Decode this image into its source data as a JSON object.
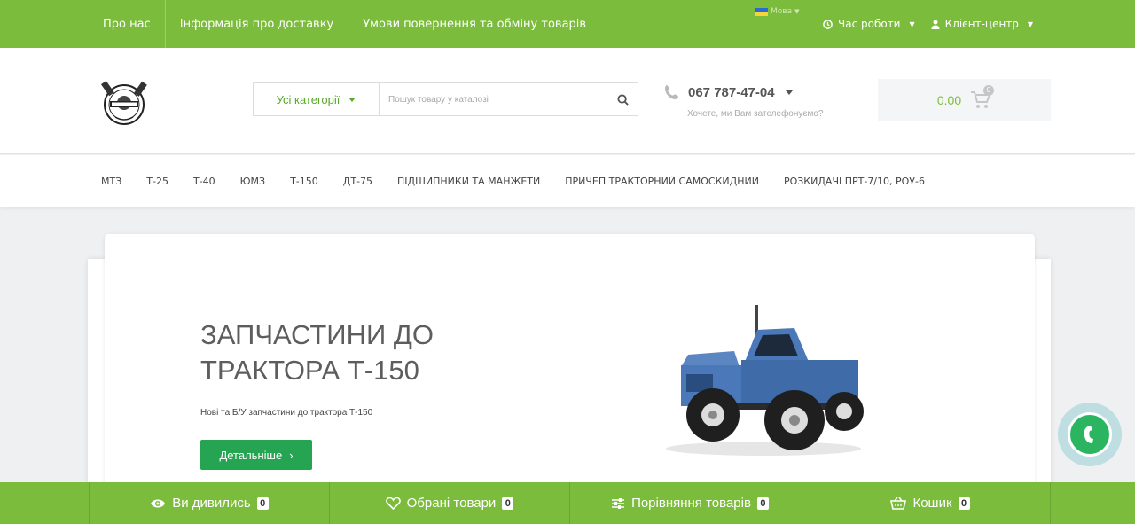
{
  "topbar": {
    "links": [
      "Про нас",
      "Інформація про доставку",
      "Умови повернення та обміну товарів"
    ],
    "language": "Мова",
    "hours": "Час роботи",
    "client_center": "Клієнт-центр"
  },
  "search": {
    "category_label": "Усі категорії",
    "placeholder": "Пошук товару у каталозі"
  },
  "phone": {
    "number": "067 787-47-04",
    "callback": "Хочете, ми Вам зателефонуємо?"
  },
  "cart": {
    "total": "0.00",
    "count": "0"
  },
  "menu": {
    "items": [
      "МТЗ",
      "Т-25",
      "Т-40",
      "ЮМЗ",
      "Т-150",
      "ДТ-75",
      "ПІДШИПНИКИ ТА МАНЖЕТИ",
      "ПРИЧЕП ТРАКТОРНИЙ САМОСКИДНИЙ",
      "РОЗКИДАЧІ ПРТ-7/10, РОУ-6"
    ]
  },
  "slide": {
    "title": "ЗАПЧАСТИНИ ДО ТРАКТОРА Т-150",
    "subtitle": "Нові та Б/У запчастини до трактора Т-150",
    "button": "Детальніше"
  },
  "bottombar": {
    "items": [
      {
        "label": "Ви дивились",
        "count": "0",
        "icon": "eye-icon"
      },
      {
        "label": "Обрані товари",
        "count": "0",
        "icon": "heart-icon"
      },
      {
        "label": "Порівняння товарів",
        "count": "0",
        "icon": "sliders-icon"
      },
      {
        "label": "Кошик",
        "count": "0",
        "icon": "basket-icon"
      }
    ]
  },
  "colors": {
    "brand_green": "#7cbc3d",
    "button_green": "#25a451",
    "tractor_blue": "#4a78b8"
  }
}
